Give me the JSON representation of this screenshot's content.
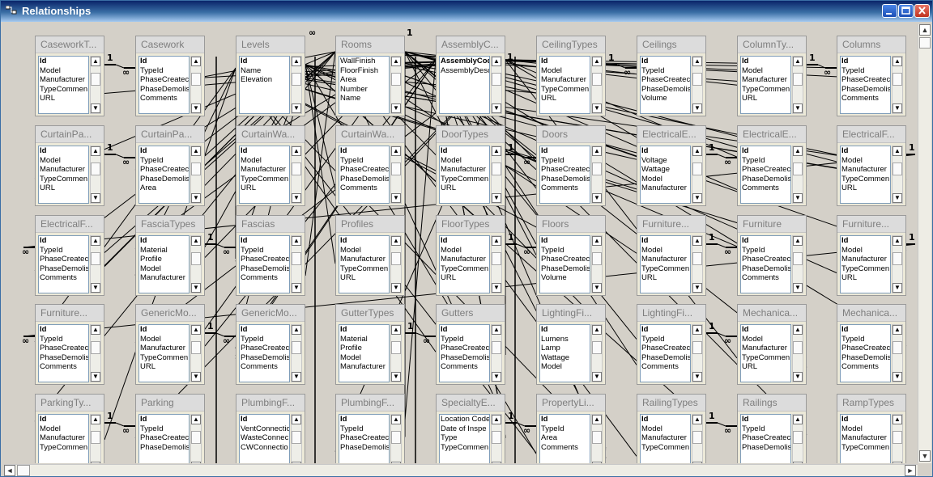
{
  "window": {
    "title": "Relationships"
  },
  "tables": [
    {
      "name": "CaseworkT...",
      "fields": [
        "Id",
        "Model",
        "Manufacturer",
        "TypeCommen",
        "URL"
      ]
    },
    {
      "name": "Casework",
      "fields": [
        "Id",
        "TypeId",
        "PhaseCreatec",
        "PhaseDemolis",
        "Comments"
      ]
    },
    {
      "name": "Levels",
      "fields": [
        "Id",
        "Name",
        "Elevation"
      ]
    },
    {
      "name": "Rooms",
      "fields": [
        "WallFinish",
        "FloorFinish",
        "Area",
        "Number",
        "Name"
      ]
    },
    {
      "name": "AssemblyC...",
      "fields": [
        "AssemblyCode",
        "AssemblyDescript"
      ]
    },
    {
      "name": "CeilingTypes",
      "fields": [
        "Id",
        "Model",
        "Manufacturer",
        "TypeCommen",
        "URL"
      ]
    },
    {
      "name": "Ceilings",
      "fields": [
        "Id",
        "TypeId",
        "PhaseCreatec",
        "PhaseDemolis",
        "Volume"
      ]
    },
    {
      "name": "ColumnTy...",
      "fields": [
        "Id",
        "Model",
        "Manufacturer",
        "TypeCommen",
        "URL"
      ]
    },
    {
      "name": "Columns",
      "fields": [
        "Id",
        "TypeId",
        "PhaseCreatec",
        "PhaseDemolis",
        "Comments"
      ]
    },
    {
      "name": "CurtainPa...",
      "fields": [
        "Id",
        "Model",
        "Manufacturer",
        "TypeCommen",
        "URL"
      ]
    },
    {
      "name": "CurtainPa...",
      "fields": [
        "Id",
        "TypeId",
        "PhaseCreatec",
        "PhaseDemolis",
        "Area"
      ]
    },
    {
      "name": "CurtainWa...",
      "fields": [
        "Id",
        "Model",
        "Manufacturer",
        "TypeCommen",
        "URL"
      ]
    },
    {
      "name": "CurtainWa...",
      "fields": [
        "Id",
        "TypeId",
        "PhaseCreatec",
        "PhaseDemolis",
        "Comments"
      ]
    },
    {
      "name": "DoorTypes",
      "fields": [
        "Id",
        "Model",
        "Manufacturer",
        "TypeCommen",
        "URL"
      ]
    },
    {
      "name": "Doors",
      "fields": [
        "Id",
        "TypeId",
        "PhaseCreatec",
        "PhaseDemolis",
        "Comments"
      ]
    },
    {
      "name": "ElectricalE...",
      "fields": [
        "Id",
        "Voltage",
        "Wattage",
        "Model",
        "Manufacturer"
      ]
    },
    {
      "name": "ElectricalE...",
      "fields": [
        "Id",
        "TypeId",
        "PhaseCreatec",
        "PhaseDemolis",
        "Comments"
      ]
    },
    {
      "name": "ElectricalF...",
      "fields": [
        "Id",
        "Model",
        "Manufacturer",
        "TypeCommen",
        "URL"
      ]
    },
    {
      "name": "ElectricalF...",
      "fields": [
        "Id",
        "TypeId",
        "PhaseCreatec",
        "PhaseDemolis",
        "Comments"
      ]
    },
    {
      "name": "FasciaTypes",
      "fields": [
        "Id",
        "Material",
        "Profile",
        "Model",
        "Manufacturer"
      ]
    },
    {
      "name": "Fascias",
      "fields": [
        "Id",
        "TypeId",
        "PhaseCreatec",
        "PhaseDemolis",
        "Comments"
      ]
    },
    {
      "name": "Profiles",
      "fields": [
        "Id",
        "Model",
        "Manufacturer",
        "TypeCommen",
        "URL"
      ]
    },
    {
      "name": "FloorTypes",
      "fields": [
        "Id",
        "Model",
        "Manufacturer",
        "TypeCommen",
        "URL"
      ]
    },
    {
      "name": "Floors",
      "fields": [
        "Id",
        "TypeId",
        "PhaseCreatec",
        "PhaseDemolis",
        "Volume"
      ]
    },
    {
      "name": "Furniture...",
      "fields": [
        "Id",
        "Model",
        "Manufacturer",
        "TypeCommen",
        "URL"
      ]
    },
    {
      "name": "Furniture",
      "fields": [
        "Id",
        "TypeId",
        "PhaseCreatec",
        "PhaseDemolis",
        "Comments"
      ]
    },
    {
      "name": "Furniture...",
      "fields": [
        "Id",
        "Model",
        "Manufacturer",
        "TypeCommen",
        "URL"
      ]
    },
    {
      "name": "Furniture...",
      "fields": [
        "Id",
        "TypeId",
        "PhaseCreatec",
        "PhaseDemolis",
        "Comments"
      ]
    },
    {
      "name": "GenericMo...",
      "fields": [
        "Id",
        "Model",
        "Manufacturer",
        "TypeCommen",
        "URL"
      ]
    },
    {
      "name": "GenericMo...",
      "fields": [
        "Id",
        "TypeId",
        "PhaseCreatec",
        "PhaseDemolis",
        "Comments"
      ]
    },
    {
      "name": "GutterTypes",
      "fields": [
        "Id",
        "Material",
        "Profile",
        "Model",
        "Manufacturer"
      ]
    },
    {
      "name": "Gutters",
      "fields": [
        "Id",
        "TypeId",
        "PhaseCreatec",
        "PhaseDemolis",
        "Comments"
      ]
    },
    {
      "name": "LightingFi...",
      "fields": [
        "Id",
        "Lumens",
        "Lamp",
        "Wattage",
        "Model"
      ]
    },
    {
      "name": "LightingFi...",
      "fields": [
        "Id",
        "TypeId",
        "PhaseCreatec",
        "PhaseDemolis",
        "Comments"
      ]
    },
    {
      "name": "Mechanica...",
      "fields": [
        "Id",
        "Model",
        "Manufacturer",
        "TypeCommen",
        "URL"
      ]
    },
    {
      "name": "Mechanica...",
      "fields": [
        "Id",
        "TypeId",
        "PhaseCreatec",
        "PhaseDemolis",
        "Comments"
      ]
    },
    {
      "name": "ParkingTy...",
      "fields": [
        "Id",
        "Model",
        "Manufacturer",
        "TypeCommen"
      ]
    },
    {
      "name": "Parking",
      "fields": [
        "Id",
        "TypeId",
        "PhaseCreatec",
        "PhaseDemolis"
      ]
    },
    {
      "name": "PlumbingF...",
      "fields": [
        "Id",
        "VentConnectio",
        "WasteConnec",
        "CWConnectio"
      ]
    },
    {
      "name": "PlumbingF...",
      "fields": [
        "Id",
        "TypeId",
        "PhaseCreatec",
        "PhaseDemolis"
      ]
    },
    {
      "name": "SpecialtyE...",
      "fields": [
        "Location Code",
        "Date of Inspe",
        "Type",
        "TypeCommen"
      ]
    },
    {
      "name": "PropertyLi...",
      "fields": [
        "Id",
        "TypeId",
        "Area",
        "Comments"
      ]
    },
    {
      "name": "RailingTypes",
      "fields": [
        "Id",
        "Model",
        "Manufacturer",
        "TypeCommen"
      ]
    },
    {
      "name": "Railings",
      "fields": [
        "Id",
        "TypeId",
        "PhaseCreatec",
        "PhaseDemolis"
      ]
    },
    {
      "name": "RampTypes",
      "fields": [
        "Id",
        "Model",
        "Manufacturer",
        "TypeCommen"
      ]
    }
  ],
  "relationship_labels": {
    "one": "1",
    "many": "∞"
  },
  "scroll_glyphs": {
    "up": "▲",
    "down": "▼",
    "left": "◄",
    "right": "►"
  }
}
